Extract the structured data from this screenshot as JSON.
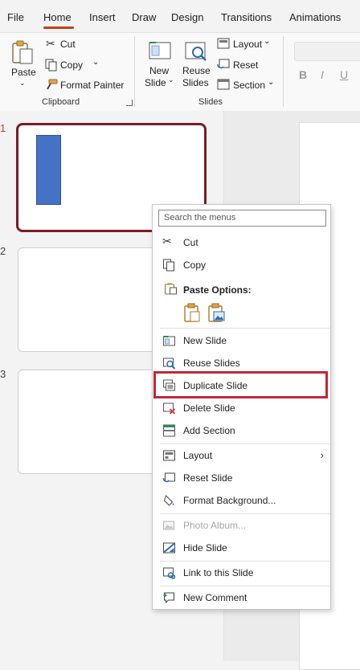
{
  "ribbon_tabs": [
    "File",
    "Home",
    "Insert",
    "Draw",
    "Design",
    "Transitions",
    "Animations"
  ],
  "active_tab": "Home",
  "clipboard": {
    "paste_label": "Paste",
    "cut_label": "Cut",
    "copy_label": "Copy",
    "format_painter_label": "Format Painter",
    "group_label": "Clipboard"
  },
  "slides_group": {
    "new_slide_line1": "New",
    "new_slide_line2": "Slide",
    "reuse_line1": "Reuse",
    "reuse_line2": "Slides",
    "layout_label": "Layout",
    "reset_label": "Reset",
    "section_label": "Section",
    "group_label": "Slides"
  },
  "font_buttons": [
    "B",
    "I",
    "U"
  ],
  "slide_numbers": [
    "1",
    "2",
    "3"
  ],
  "context_menu": {
    "search_placeholder": "Search the menus",
    "cut": "Cut",
    "copy": "Copy",
    "paste_options": "Paste Options:",
    "new_slide": "New Slide",
    "reuse_slides": "Reuse Slides",
    "duplicate_slide": "Duplicate Slide",
    "delete_slide": "Delete Slide",
    "add_section": "Add Section",
    "layout": "Layout",
    "reset_slide": "Reset Slide",
    "format_background": "Format Background...",
    "photo_album": "Photo Album...",
    "hide_slide": "Hide Slide",
    "link_to_slide": "Link to this Slide",
    "new_comment": "New Comment"
  },
  "colors": {
    "accent": "#c43e1c",
    "selected_slide_border": "#7a1c26",
    "highlight_box": "#c0283a",
    "shape_fill": "#4472c4"
  }
}
